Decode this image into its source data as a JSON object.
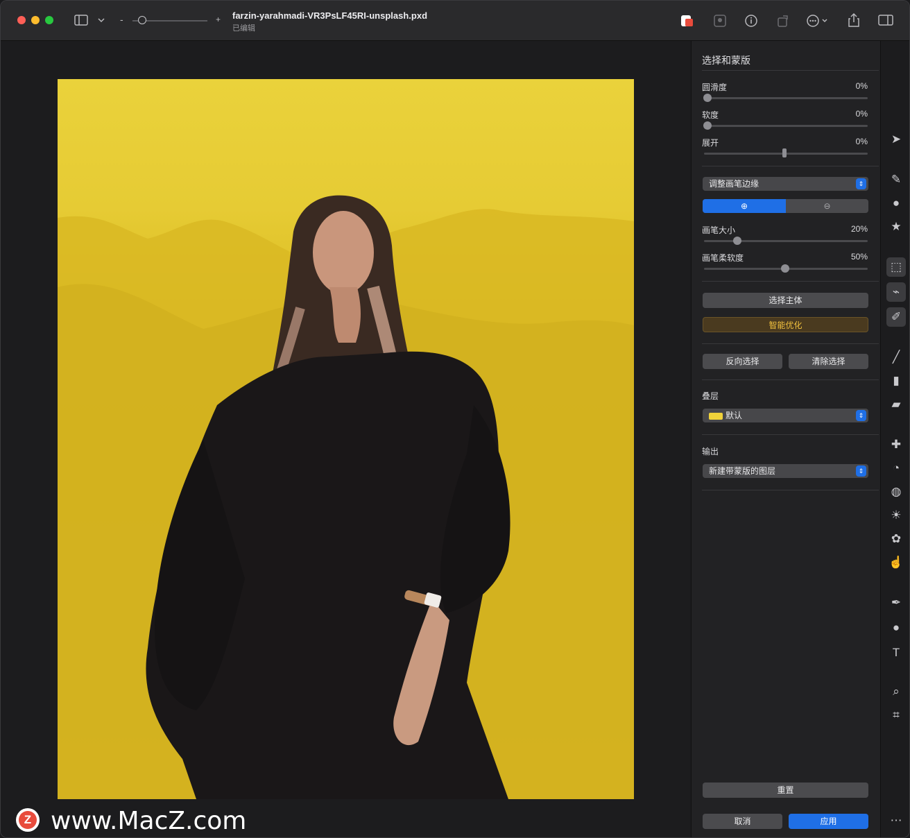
{
  "window": {
    "doc_title": "farzin-yarahmadi-VR3PsLF45RI-unsplash.pxd",
    "doc_subtitle": "已编辑"
  },
  "toolbar": {
    "icons": [
      "sidebar-toggle-icon",
      "chevron-down-icon",
      "zoom-out-icon",
      "zoom-in-icon",
      "color-adjust-icon",
      "portrait-icon",
      "info-icon",
      "rotate-icon",
      "more-icon",
      "share-icon",
      "right-sidebar-icon"
    ],
    "zoom_minus": "-",
    "zoom_plus": "+"
  },
  "panel": {
    "title": "选择和蒙版",
    "sliders": [
      {
        "label": "圆滑度",
        "value": "0%",
        "level": 0
      },
      {
        "label": "软度",
        "value": "0%",
        "level": 0
      },
      {
        "label": "展开",
        "value": "0%",
        "level": 0.5
      }
    ],
    "brush_mode_select": "调整画笔边缘",
    "brush_sliders": [
      {
        "label": "画笔大小",
        "value": "20%",
        "level": 0.2
      },
      {
        "label": "画笔柔软度",
        "value": "50%",
        "level": 0.5
      }
    ],
    "select_subject_button": "选择主体",
    "smart_refine_button": "智能优化",
    "invert_button": "反向选择",
    "clear_button": "清除选择",
    "overlay_label": "叠层",
    "overlay_select": "默认",
    "output_label": "输出",
    "output_select": "新建带蒙版的图层",
    "reset_button": "重置",
    "cancel_button": "取消",
    "apply_button": "应用"
  },
  "watermark": {
    "logo_letter": "Z",
    "text": "www.MacZ.com"
  },
  "colors": {
    "accent": "#1f6fe6",
    "overlay_yellow": "#e6cb34",
    "smart_text": "#f2c23e"
  }
}
